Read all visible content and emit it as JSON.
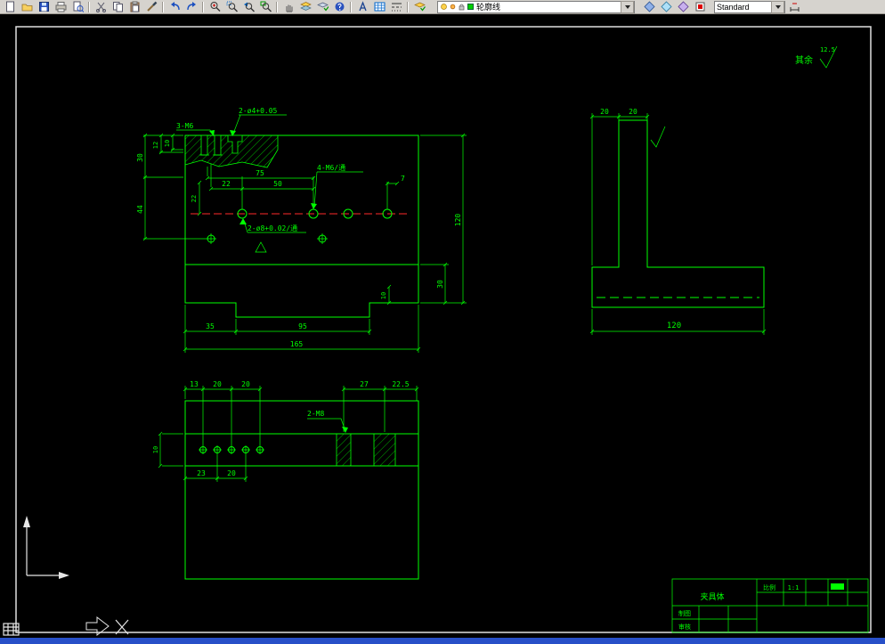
{
  "toolbar": {
    "layer_value": "轮廓线",
    "style_value": "Standard",
    "icons": [
      "new",
      "open",
      "save",
      "print",
      "print-preview",
      "cut",
      "copy",
      "paste",
      "match-properties",
      "undo",
      "redo",
      "zoom-realtime",
      "zoom-window",
      "zoom-previous",
      "zoom-extents",
      "pan",
      "layers",
      "layer-properties",
      "help",
      "text-style",
      "table",
      "linetype",
      "layer-control",
      "make-object-layer-current",
      "layer-states",
      "color-control",
      "dim-style"
    ]
  },
  "notes": {
    "surface_prefix": "其余",
    "surface_roughness": "12.5"
  },
  "front_view": {
    "labels": {
      "thread_top": "3-M6",
      "counterbore": "2-ø4+0.05",
      "thread_mid": "4-M6/通",
      "through_holes": "2-ø8+0.02/通"
    },
    "dims": {
      "d12": "12",
      "d10_top": "10",
      "d30_left": "30",
      "d44": "44",
      "d22_v": "22",
      "d22_h": "22",
      "d50": "50",
      "d75": "75",
      "d7": "7",
      "d120": "120",
      "d30_right": "30",
      "d10_right": "10",
      "d35": "35",
      "d95": "95",
      "d165": "165"
    }
  },
  "side_view": {
    "dims": {
      "d20_left": "20",
      "d20_right": "20",
      "d120": "120"
    }
  },
  "bottom_view": {
    "labels": {
      "thread": "2-M8"
    },
    "dims": {
      "d13": "13",
      "d20_a": "20",
      "d20_b": "20",
      "d27": "27",
      "d22_5": "22.5",
      "d10": "10",
      "d23": "23",
      "d20_c": "20"
    }
  },
  "title_block": {
    "part_name": "夹具体",
    "scale_label": "比例",
    "scale_value": "1:1",
    "drawn_label": "制图",
    "checked_label": "审核"
  }
}
